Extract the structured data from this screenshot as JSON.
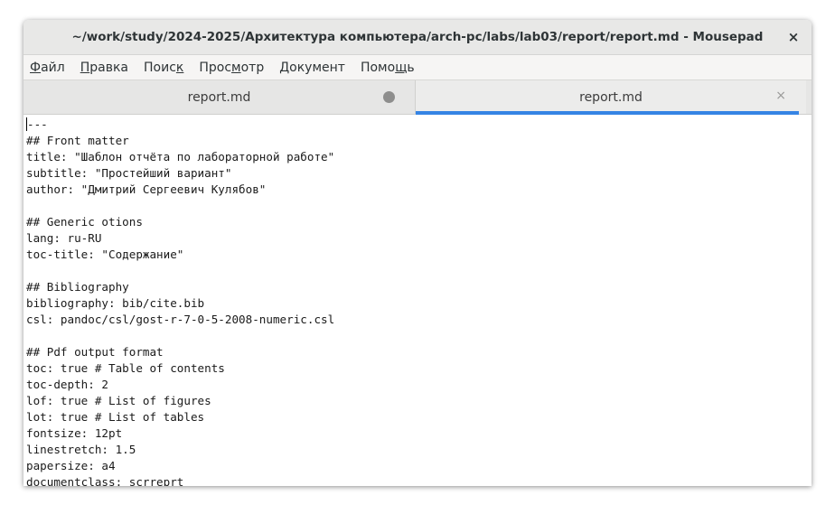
{
  "window": {
    "title": "~/work/study/2024-2025/Архитектура компьютера/arch-pc/labs/lab03/report/report.md - Mousepad",
    "close_glyph": "×"
  },
  "menu": [
    {
      "accel": "Ф",
      "rest": "айл",
      "pre": ""
    },
    {
      "accel": "П",
      "rest": "равка",
      "pre": ""
    },
    {
      "pre": "Поис",
      "accel": "к",
      "rest": ""
    },
    {
      "pre": "Прос",
      "accel": "м",
      "rest": "отр"
    },
    {
      "pre": "",
      "accel": "Д",
      "rest": "окумент"
    },
    {
      "pre": "Помо",
      "accel": "щ",
      "rest": "ь"
    }
  ],
  "tabs": [
    {
      "label": "report.md",
      "state": "modified"
    },
    {
      "label": "report.md",
      "state": "active",
      "close_glyph": "×"
    }
  ],
  "editor": {
    "lines": [
      "---",
      "## Front matter",
      "title: \"Шаблон отчёта по лабораторной работе\"",
      "subtitle: \"Простейший вариант\"",
      "author: \"Дмитрий Сергеевич Кулябов\"",
      "",
      "## Generic otions",
      "lang: ru-RU",
      "toc-title: \"Содержание\"",
      "",
      "## Bibliography",
      "bibliography: bib/cite.bib",
      "csl: pandoc/csl/gost-r-7-0-5-2008-numeric.csl",
      "",
      "## Pdf output format",
      "toc: true # Table of contents",
      "toc-depth: 2",
      "lof: true # List of figures",
      "lot: true # List of tables",
      "fontsize: 12pt",
      "linestretch: 1.5",
      "papersize: a4",
      "documentclass: scrreprt"
    ]
  },
  "colors": {
    "accent": "#3584e4",
    "titlebar": "#e8e8e7",
    "menubar": "#f6f5f4"
  }
}
